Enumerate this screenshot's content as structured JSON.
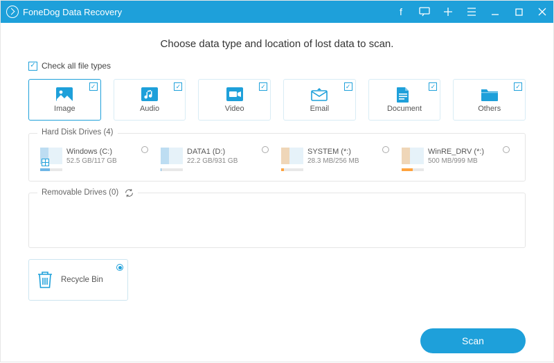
{
  "titlebar": {
    "title": "FoneDog Data Recovery"
  },
  "heading": "Choose data type and location of lost data to scan.",
  "checkall": {
    "label": "Check all file types",
    "checked": true
  },
  "types": [
    {
      "key": "image",
      "label": "Image",
      "checked": true
    },
    {
      "key": "audio",
      "label": "Audio",
      "checked": true
    },
    {
      "key": "video",
      "label": "Video",
      "checked": true
    },
    {
      "key": "email",
      "label": "Email",
      "checked": true
    },
    {
      "key": "document",
      "label": "Document",
      "checked": true
    },
    {
      "key": "others",
      "label": "Others",
      "checked": true
    }
  ],
  "hdd": {
    "title": "Hard Disk Drives (4)",
    "drives": [
      {
        "name": "Windows (C:)",
        "size": "52.5 GB/117 GB",
        "fill_pct": 45,
        "color": "#6fb7e6",
        "is_os": true
      },
      {
        "name": "DATA1 (D:)",
        "size": "22.2 GB/931 GB",
        "fill_pct": 3,
        "color": "#6fb7e6",
        "is_os": false
      },
      {
        "name": "SYSTEM (*:)",
        "size": "28.3 MB/256 MB",
        "fill_pct": 11,
        "color": "#ffa33e",
        "is_os": false
      },
      {
        "name": "WinRE_DRV (*:)",
        "size": "500 MB/999 MB",
        "fill_pct": 50,
        "color": "#ffa33e",
        "is_os": false
      }
    ]
  },
  "removable": {
    "title": "Removable Drives (0)"
  },
  "recycle": {
    "label": "Recycle Bin",
    "selected": true
  },
  "scan_label": "Scan"
}
